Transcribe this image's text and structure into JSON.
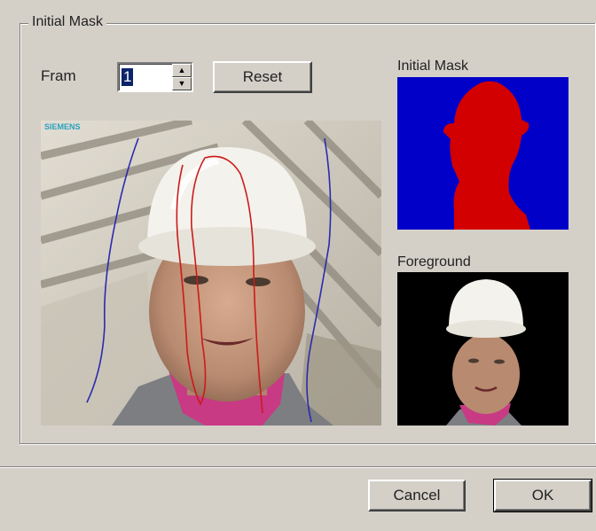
{
  "group": {
    "title": "Initial Mask"
  },
  "controls": {
    "frame_label": "Fram",
    "frame_value": "1",
    "reset_label": "Reset"
  },
  "video": {
    "watermark": "SIEMENS"
  },
  "panels": {
    "mask_label": "Initial Mask",
    "foreground_label": "Foreground"
  },
  "footer": {
    "cancel_label": "Cancel",
    "ok_label": "OK"
  },
  "colors": {
    "dialog_bg": "#d4d0c8",
    "mask_background": "#0000c8",
    "mask_foreground": "#d20000",
    "stroke_foreground": "#cc1a1a",
    "stroke_background": "#2a2ab0",
    "selection": "#0a246a"
  },
  "icons": {
    "spin_up": "up-arrow-icon",
    "spin_down": "down-arrow-icon"
  }
}
